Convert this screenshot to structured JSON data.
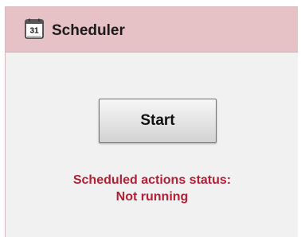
{
  "header": {
    "title": "Scheduler",
    "icon": "calendar-icon",
    "icon_day": "31"
  },
  "controls": {
    "start_label": "Start"
  },
  "status": {
    "label": "Scheduled actions status:",
    "value": "Not running",
    "color": "#b32035"
  },
  "colors": {
    "header_background": "#e6c1c6",
    "panel_background": "#f1f1f1"
  }
}
